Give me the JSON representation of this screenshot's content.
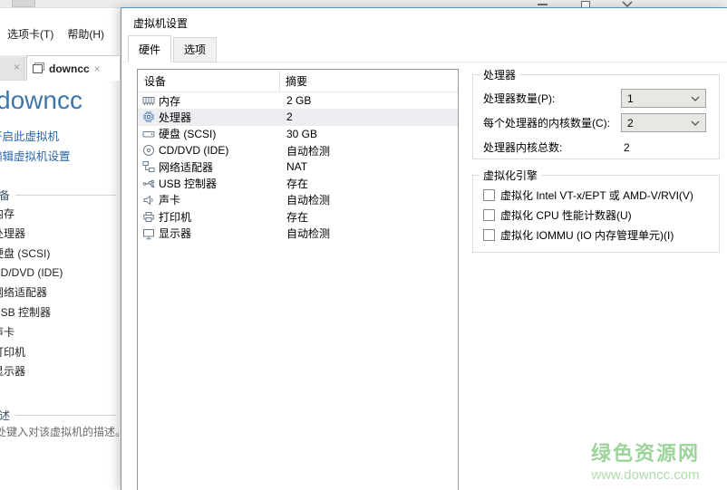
{
  "colors": {
    "accent_blue": "#3e76ab",
    "link_blue": "#2a66a8",
    "dialog_top_border": "#4e94c4",
    "selection_bg": "#eceef1",
    "watermark_green": "#9cd49a",
    "watermark_green_light": "#aedcab"
  },
  "background_window": {
    "menu_items": [
      "选项卡(T)",
      "帮助(H)"
    ],
    "active_tab_label": "downcc",
    "vm_title": "downcc",
    "action_links": [
      "开启此虚拟机",
      "编辑虚拟机设置"
    ],
    "devices_section": {
      "title": "设备",
      "items": [
        "内存",
        "处理器",
        "硬盘 (SCSI)",
        "CD/DVD (IDE)",
        "网络适配器",
        "USB 控制器",
        "声卡",
        "打印机",
        "显示器"
      ]
    },
    "description_section": {
      "title": "描述",
      "placeholder": "在此处键入对该虚拟机的描述。"
    }
  },
  "dialog": {
    "title": "虚拟机设置",
    "tabs": [
      {
        "label": "硬件",
        "active": true
      },
      {
        "label": "选项",
        "active": false
      }
    ],
    "device_table": {
      "columns": [
        "设备",
        "摘要"
      ],
      "rows": [
        {
          "icon": "memory-icon",
          "device": "内存",
          "summary": "2 GB",
          "selected": false
        },
        {
          "icon": "cpu-icon",
          "device": "处理器",
          "summary": "2",
          "selected": true
        },
        {
          "icon": "disk-icon",
          "device": "硬盘 (SCSI)",
          "summary": "30 GB",
          "selected": false
        },
        {
          "icon": "cd-icon",
          "device": "CD/DVD (IDE)",
          "summary": "自动检测",
          "selected": false
        },
        {
          "icon": "network-icon",
          "device": "网络适配器",
          "summary": "NAT",
          "selected": false
        },
        {
          "icon": "usb-icon",
          "device": "USB 控制器",
          "summary": "存在",
          "selected": false
        },
        {
          "icon": "sound-icon",
          "device": "声卡",
          "summary": "自动检测",
          "selected": false
        },
        {
          "icon": "printer-icon",
          "device": "打印机",
          "summary": "存在",
          "selected": false
        },
        {
          "icon": "display-icon",
          "device": "显示器",
          "summary": "自动检测",
          "selected": false
        }
      ]
    },
    "processor_group": {
      "title": "处理器",
      "fields": [
        {
          "label": "处理器数量(P):",
          "value": "1",
          "type": "select"
        },
        {
          "label": "每个处理器的内核数量(C):",
          "value": "2",
          "type": "select"
        },
        {
          "label": "处理器内核总数:",
          "value": "2",
          "type": "static"
        }
      ]
    },
    "virtualization_group": {
      "title": "虚拟化引擎",
      "checkboxes": [
        {
          "label": "虚拟化 Intel VT-x/EPT 或 AMD-V/RVI(V)",
          "checked": false
        },
        {
          "label": "虚拟化 CPU 性能计数器(U)",
          "checked": false
        },
        {
          "label": "虚拟化 IOMMU (IO 内存管理单元)(I)",
          "checked": false
        }
      ]
    }
  },
  "watermark": {
    "title": "绿色资源网",
    "url": "www.downcc.com"
  }
}
